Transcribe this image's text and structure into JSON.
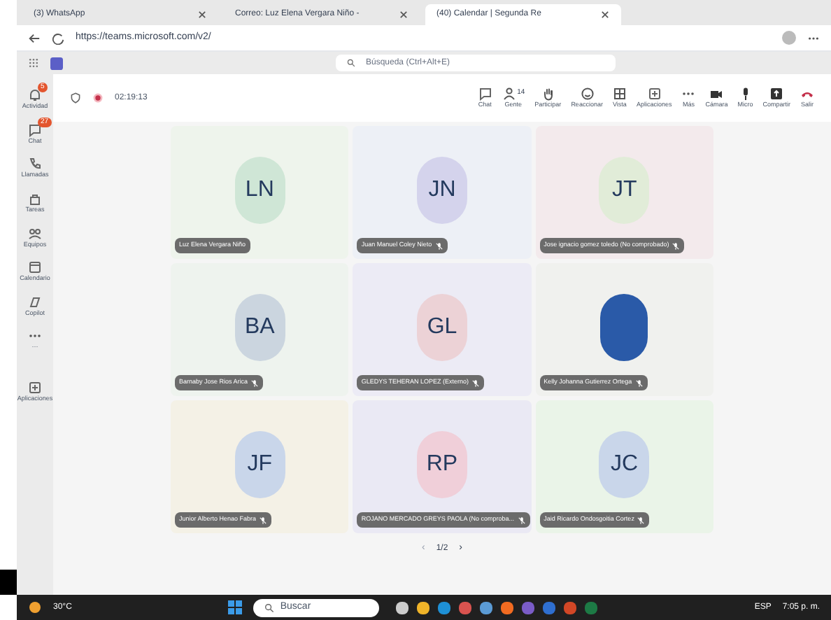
{
  "browser": {
    "tabs": [
      {
        "label": "(3) WhatsApp",
        "selected": false
      },
      {
        "label": "Correo: Luz Elena Vergara Niño -",
        "selected": false
      },
      {
        "label": "(40) Calendar | Segunda Re",
        "selected": true
      }
    ],
    "url": "https://teams.microsoft.com/v2/"
  },
  "teams": {
    "search": {
      "placeholder": "Búsqueda (Ctrl+Alt+E)"
    },
    "rail": [
      {
        "label": "Actividad",
        "badge": "5"
      },
      {
        "label": "Chat",
        "badge": "27"
      },
      {
        "label": "Llamadas"
      },
      {
        "label": "Tareas"
      },
      {
        "label": "Equipos"
      },
      {
        "label": "Calendario"
      },
      {
        "label": "Copilot"
      },
      {
        "label": "···"
      },
      {
        "label": "Aplicaciones"
      }
    ],
    "timer": "02:19:13",
    "toolbar": [
      {
        "label": "Chat",
        "kind": "chat"
      },
      {
        "label": "Gente",
        "count": "14",
        "kind": "people"
      },
      {
        "label": "Participar",
        "kind": "hand"
      },
      {
        "label": "Reaccionar",
        "kind": "smile"
      },
      {
        "label": "Vista",
        "kind": "grid"
      },
      {
        "label": "Aplicaciones",
        "kind": "plus"
      },
      {
        "label": "Más",
        "kind": "more"
      },
      {
        "label": "Cámara",
        "kind": "camera"
      },
      {
        "label": "Micro",
        "kind": "mic"
      },
      {
        "label": "Compartir",
        "kind": "share"
      },
      {
        "label": "Salir",
        "kind": "leave"
      }
    ],
    "participants": [
      {
        "name": "Luz Elena Vergara Niño",
        "initials": "LN",
        "kind": "initials",
        "color": "#cfe6d6",
        "muted": false
      },
      {
        "name": "Juan Manuel Coley Nieto",
        "initials": "JN",
        "kind": "initials",
        "color": "#d4d3ec",
        "muted": true
      },
      {
        "name": "Jose ignacio gomez toledo (No comprobado)",
        "initials": "JT",
        "kind": "initials",
        "color": "#e1ecd8",
        "muted": true
      },
      {
        "name": "Barnaby Jose Rios Arica",
        "initials": "BA",
        "kind": "initials",
        "color": "#cbd5df",
        "muted": true
      },
      {
        "name": "GLEDYS TEHERAN LOPEZ (Externo)",
        "initials": "GL",
        "kind": "initials",
        "color": "#ecd2d6",
        "muted": true
      },
      {
        "name": "Kelly Johanna Gutierrez Ortega",
        "kind": "photo",
        "muted": true
      },
      {
        "name": "Junior Alberto Henao Fabra",
        "initials": "JF",
        "kind": "initials",
        "color": "#c9d6ea",
        "muted": true
      },
      {
        "name": "ROJANO MERCADO GREYS PAOLA (No comproba...",
        "initials": "RP",
        "kind": "initials",
        "color": "#f0cfd9",
        "muted": true
      },
      {
        "name": "Jaid Ricardo Ondosgoitia Cortez",
        "initials": "JC",
        "kind": "initials",
        "color": "#c9d6ea",
        "muted": true
      }
    ],
    "pager": {
      "prev": "‹",
      "label": "1/2",
      "next": "›"
    }
  },
  "taskbar": {
    "weather": "30°C",
    "search": "Buscar",
    "lang": "ESP",
    "time": "7:05 p. m."
  }
}
